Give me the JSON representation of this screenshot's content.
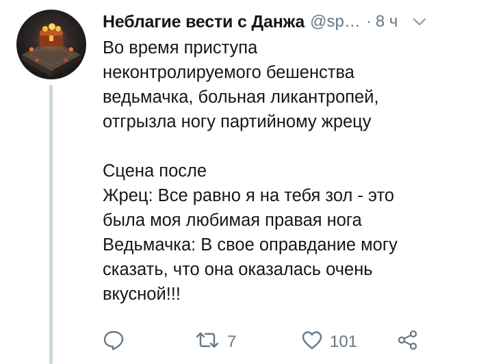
{
  "tweet": {
    "display_name": "Неблагие вести с Данжа",
    "handle": "@sp…",
    "separator": "·",
    "time": "8 ч",
    "lines": [
      "Во время приступа",
      "неконтролируемого бешенства",
      "ведьмачка, больная ликантропей,",
      "отгрызла ногу партийному жрецу",
      "",
      "Сцена после",
      "Жрец: Все равно я на тебя зол - это",
      "была моя любимая правая нога",
      "Ведьмачка: В свое оправдание могу",
      "сказать, что она оказалась очень",
      "вкусной!!!"
    ],
    "actions": {
      "reply_icon": "reply-icon",
      "retweet_icon": "retweet-icon",
      "retweet_count": "7",
      "like_icon": "heart-icon",
      "like_count": "101",
      "share_icon": "share-icon"
    }
  },
  "colors": {
    "text": "#14171a",
    "secondary": "#657786",
    "thread_line": "#ccd6dd"
  }
}
